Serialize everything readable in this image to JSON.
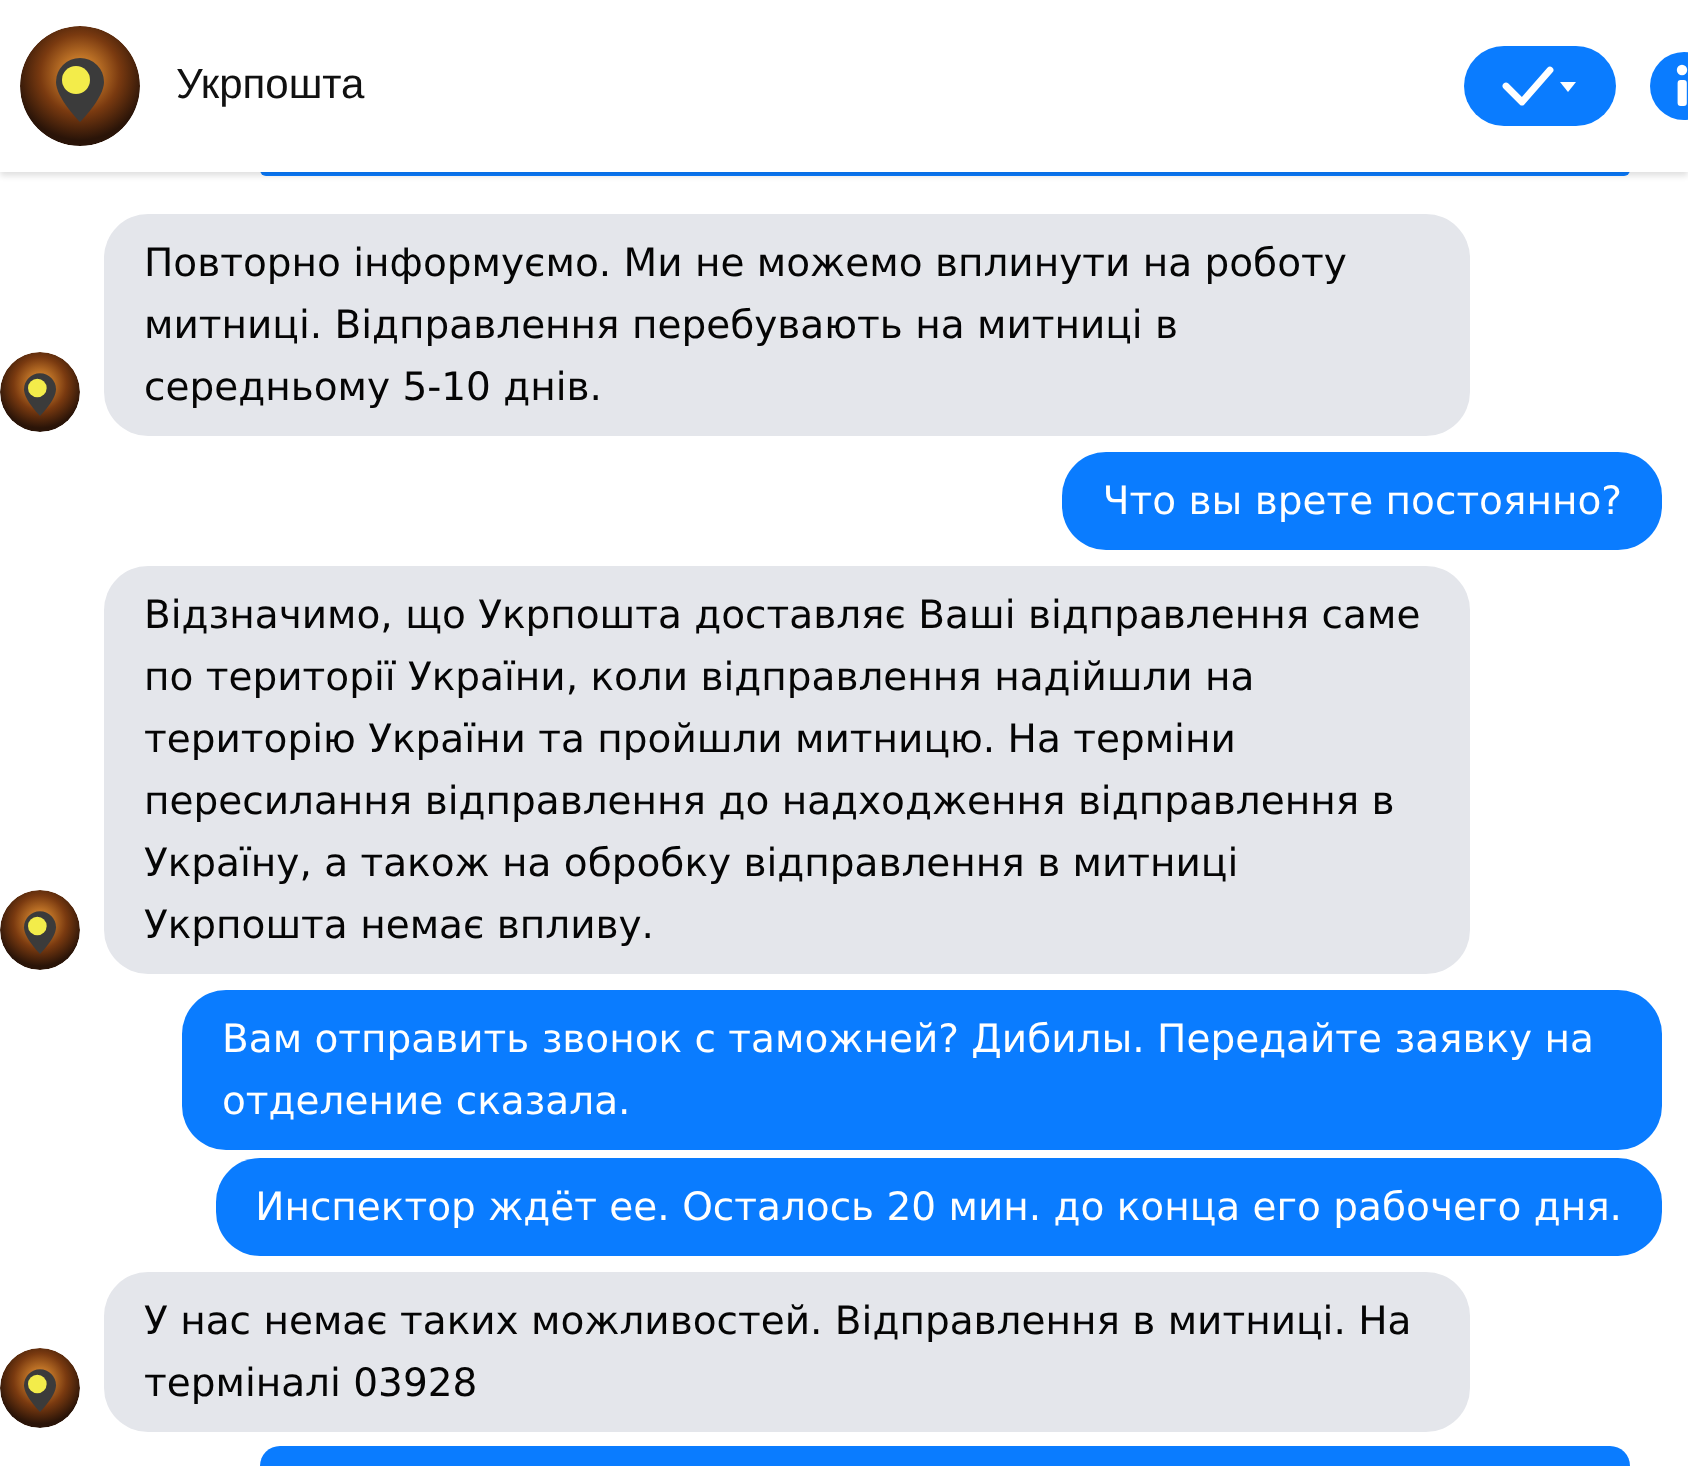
{
  "header": {
    "title": "Укрпошта"
  },
  "messages": [
    {
      "kind": "cut"
    },
    {
      "kind": "incoming",
      "text": "Повторно інформуємо. Ми не можемо вплинути на роботу митниці.  Відправлення перебувають на митниці в середньому 5-10 днів."
    },
    {
      "kind": "outgoing",
      "text": "Что вы врете постоянно?"
    },
    {
      "kind": "incoming",
      "text": "Відзначимо, що Укрпошта доставляє Ваші відправлення саме по території України, коли відправлення надійшли на територію України та пройшли митницю. На терміни пересилання відправлення до надходження відправлення в Україну, а також на обробку відправлення в митниці Укрпошта немає впливу."
    },
    {
      "kind": "outgoing",
      "text": "Вам отправить звонок с таможней? Дибилы. Передайте заявку на отделение сказала."
    },
    {
      "kind": "outgoing",
      "text": "Инспектор ждёт ее. Осталось 20 мин. до конца его рабочего дня."
    },
    {
      "kind": "incoming",
      "text": "У нас немає таких можливостей. Відправлення в митниці. На терміналі 03928"
    },
    {
      "kind": "cut"
    }
  ]
}
